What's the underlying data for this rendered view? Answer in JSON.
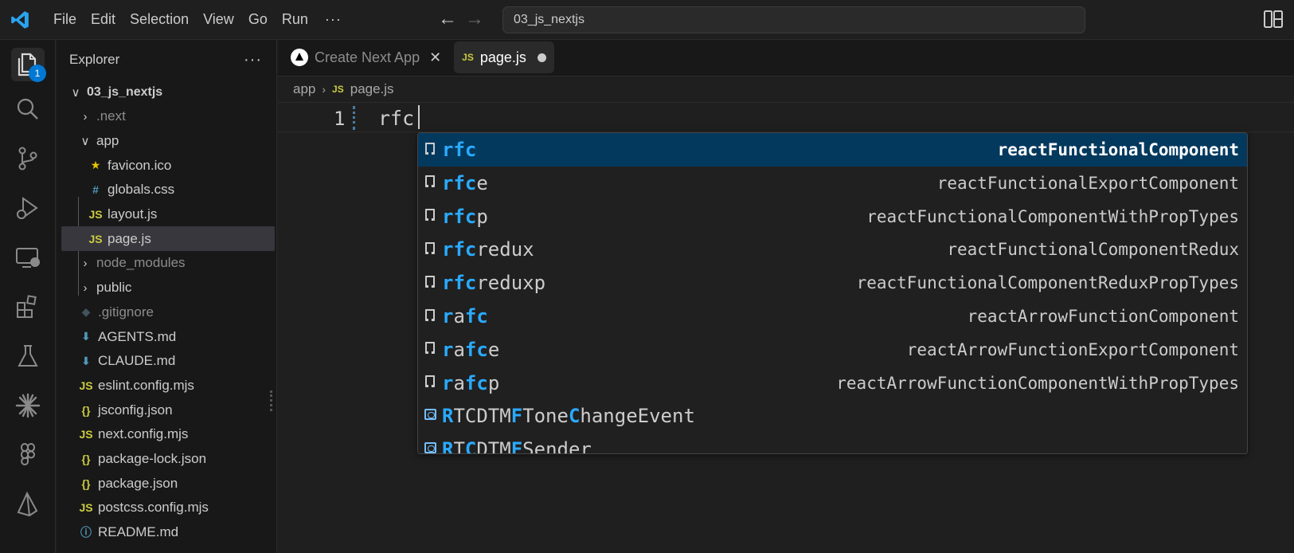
{
  "titlebar": {
    "menu": [
      "File",
      "Edit",
      "Selection",
      "View",
      "Go",
      "Run"
    ],
    "more": "···",
    "search_text": "03_js_nextjs"
  },
  "activity": {
    "explorer_badge": "1"
  },
  "sidebar": {
    "title": "Explorer",
    "more": "···",
    "tree": [
      {
        "label": "03_js_nextjs",
        "chev": "∨",
        "icon": "",
        "icon_kind": "none"
      },
      {
        "label": ".next",
        "chev": "›",
        "icon": "",
        "icon_kind": "none"
      },
      {
        "label": "app",
        "chev": "∨",
        "icon": "",
        "icon_kind": "none"
      },
      {
        "label": "favicon.ico",
        "chev": "",
        "icon": "★",
        "icon_kind": "star"
      },
      {
        "label": "globals.css",
        "chev": "",
        "icon": "#",
        "icon_kind": "css"
      },
      {
        "label": "layout.js",
        "chev": "",
        "icon": "JS",
        "icon_kind": "js"
      },
      {
        "label": "page.js",
        "chev": "",
        "icon": "JS",
        "icon_kind": "js"
      },
      {
        "label": "node_modules",
        "chev": "›",
        "icon": "",
        "icon_kind": "none"
      },
      {
        "label": "public",
        "chev": "›",
        "icon": "",
        "icon_kind": "none"
      },
      {
        "label": ".gitignore",
        "chev": "",
        "icon": "◆",
        "icon_kind": "git"
      },
      {
        "label": "AGENTS.md",
        "chev": "",
        "icon": "⬇",
        "icon_kind": "md"
      },
      {
        "label": "CLAUDE.md",
        "chev": "",
        "icon": "⬇",
        "icon_kind": "md"
      },
      {
        "label": "eslint.config.mjs",
        "chev": "",
        "icon": "JS",
        "icon_kind": "js"
      },
      {
        "label": "jsconfig.json",
        "chev": "",
        "icon": "{}",
        "icon_kind": "json"
      },
      {
        "label": "next.config.mjs",
        "chev": "",
        "icon": "JS",
        "icon_kind": "js"
      },
      {
        "label": "package-lock.json",
        "chev": "",
        "icon": "{}",
        "icon_kind": "json"
      },
      {
        "label": "package.json",
        "chev": "",
        "icon": "{}",
        "icon_kind": "json"
      },
      {
        "label": "postcss.config.mjs",
        "chev": "",
        "icon": "JS",
        "icon_kind": "js"
      },
      {
        "label": "README.md",
        "chev": "",
        "icon": "ⓘ",
        "icon_kind": "info"
      }
    ]
  },
  "editor": {
    "tabs": [
      {
        "label": "Create Next App",
        "close": "✕"
      },
      {
        "label": "page.js",
        "icon": "JS"
      }
    ],
    "breadcrumb": {
      "folder": "app",
      "sep": "›",
      "file_icon": "JS",
      "file": "page.js"
    },
    "line_number": "1",
    "code": "rfc"
  },
  "suggest": {
    "items": [
      {
        "match": "rfc",
        "rest": "",
        "detail": "reactFunctionalComponent",
        "kind": "snippet"
      },
      {
        "match": "rfc",
        "rest": "e",
        "detail": "reactFunctionalExportComponent",
        "kind": "snippet"
      },
      {
        "match": "rfc",
        "rest": "p",
        "detail": "reactFunctionalComponentWithPropTypes",
        "kind": "snippet"
      },
      {
        "match": "rfc",
        "rest": "redux",
        "detail": "reactFunctionalComponentRedux",
        "kind": "snippet"
      },
      {
        "match": "rfc",
        "rest": "reduxp",
        "detail": "reactFunctionalComponentReduxPropTypes",
        "kind": "snippet"
      },
      {
        "parts": [
          "r",
          "a",
          "fc"
        ],
        "detail": "reactArrowFunctionComponent",
        "kind": "snippet"
      },
      {
        "parts": [
          "r",
          "a",
          "fc",
          "e"
        ],
        "detail": "reactArrowFunctionExportComponent",
        "kind": "snippet"
      },
      {
        "parts": [
          "r",
          "a",
          "fc",
          "p"
        ],
        "detail": "reactArrowFunctionComponentWithPropTypes",
        "kind": "snippet"
      },
      {
        "parts": [
          "R",
          "TCDTM",
          "F",
          "Tone",
          "C",
          "hangeEvent"
        ],
        "detail": "",
        "kind": "event"
      },
      {
        "parts": [
          "R",
          "T",
          "C",
          "DTM",
          "F",
          "Sender"
        ],
        "detail": "",
        "kind": "event"
      }
    ]
  }
}
